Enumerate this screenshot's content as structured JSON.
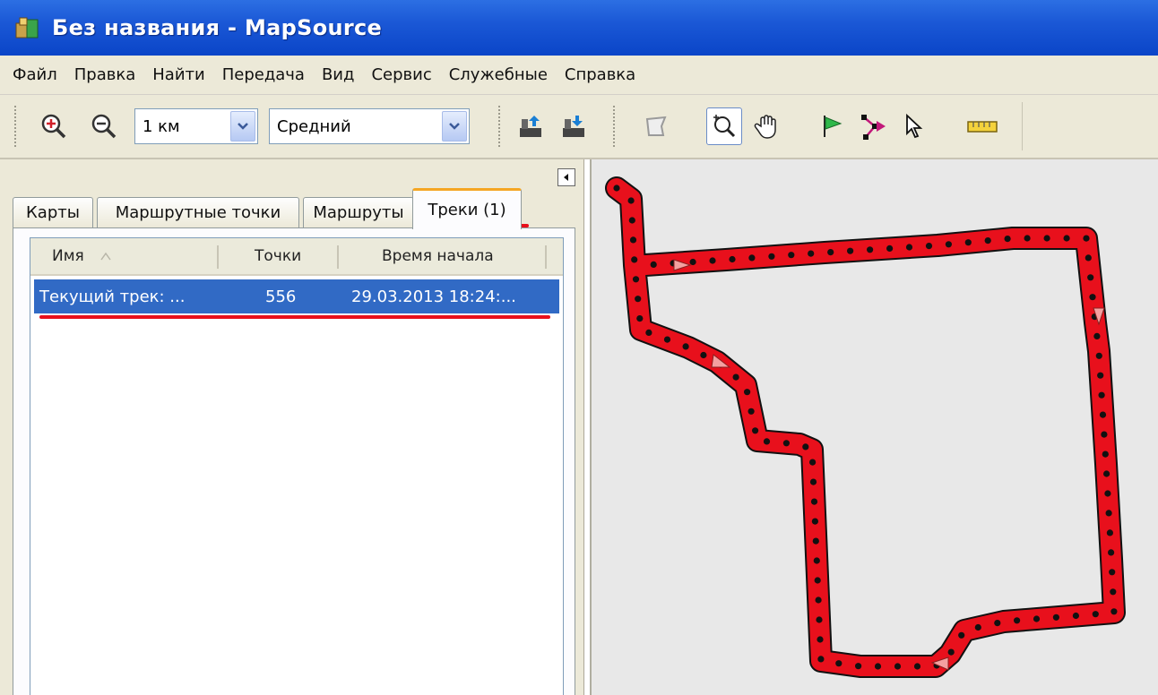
{
  "window": {
    "title": "Без названия - MapSource"
  },
  "menu": {
    "items": [
      "Файл",
      "Правка",
      "Найти",
      "Передача",
      "Вид",
      "Сервис",
      "Служебные",
      "Справка"
    ]
  },
  "toolbar": {
    "scale_value": "1 км",
    "detail_value": "Средний",
    "icons": [
      "zoom-in-icon",
      "zoom-out-icon",
      "receive-from-device-icon",
      "send-to-device-icon",
      "map-select-icon",
      "zoom-tool-icon",
      "hand-tool-icon",
      "waypoint-flag-icon",
      "route-tool-icon",
      "selection-arrow-icon",
      "distance-ruler-icon"
    ]
  },
  "tabs": [
    {
      "label": "Карты"
    },
    {
      "label": "Маршрутные точки"
    },
    {
      "label": "Маршруты"
    },
    {
      "label": "Треки (1)",
      "active": true
    }
  ],
  "track_list": {
    "columns": [
      "Имя",
      "Точки",
      "Время начала"
    ],
    "rows": [
      {
        "name": "Текущий трек: ...",
        "points": "556",
        "start_time": "29.03.2013 18:24:..."
      }
    ]
  },
  "colors": {
    "titlebar": "#0a45c8",
    "selection": "#316ac5",
    "track": "#e8101c",
    "annotation": "#e8101c"
  }
}
